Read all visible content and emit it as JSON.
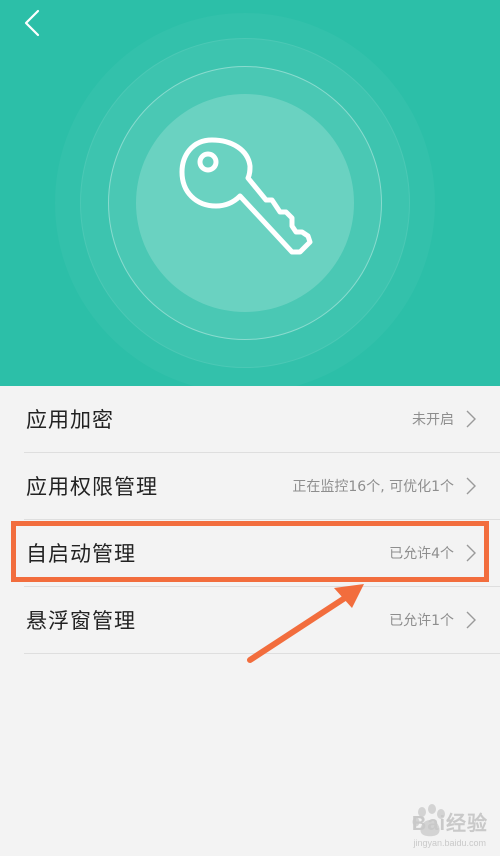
{
  "header": {
    "back_icon": "chevron-left-icon",
    "hero_icon": "key-icon",
    "background_color": "#2cbfa8"
  },
  "settings": {
    "items": [
      {
        "label": "应用加密",
        "value": "未开启"
      },
      {
        "label": "应用权限管理",
        "value": "正在监控16个, 可优化1个"
      },
      {
        "label": "自启动管理",
        "value": "已允许4个"
      },
      {
        "label": "悬浮窗管理",
        "value": "已允许1个"
      }
    ]
  },
  "annotation": {
    "highlight_color": "#f26d3d",
    "highlighted_item": "自启动管理"
  },
  "watermark": {
    "brand": "Bai",
    "brand_suffix": "经验",
    "url": "jingyan.baidu.com"
  }
}
